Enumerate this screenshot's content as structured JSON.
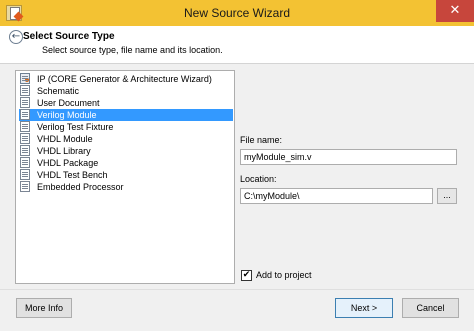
{
  "window": {
    "title": "New Source Wizard",
    "close_glyph": "✕",
    "app_icon": "ise-wizard-icon"
  },
  "header": {
    "back_glyph": "←",
    "title": "Select Source Type",
    "subtitle": "Select source type, file name and its location."
  },
  "source_types": [
    {
      "label": "IP (CORE Generator & Architecture Wizard)",
      "icon": "ip-core-icon",
      "selected": false
    },
    {
      "label": "Schematic",
      "icon": "document-icon",
      "selected": false
    },
    {
      "label": "User Document",
      "icon": "document-icon",
      "selected": false
    },
    {
      "label": "Verilog Module",
      "icon": "document-icon",
      "selected": true
    },
    {
      "label": "Verilog Test Fixture",
      "icon": "document-icon",
      "selected": false
    },
    {
      "label": "VHDL Module",
      "icon": "document-icon",
      "selected": false
    },
    {
      "label": "VHDL Library",
      "icon": "document-icon",
      "selected": false
    },
    {
      "label": "VHDL Package",
      "icon": "document-icon",
      "selected": false
    },
    {
      "label": "VHDL Test Bench",
      "icon": "document-icon",
      "selected": false
    },
    {
      "label": "Embedded Processor",
      "icon": "document-icon",
      "selected": false
    }
  ],
  "form": {
    "file_name_label": "File name:",
    "file_name_value": "myModule_sim.v",
    "location_label": "Location:",
    "location_value": "C:\\myModule\\",
    "browse_label": "...",
    "add_to_project_label": "Add to project",
    "add_to_project_checked": true,
    "check_glyph": "✔"
  },
  "buttons": {
    "more_info": "More Info",
    "next": "Next >",
    "cancel": "Cancel"
  },
  "colors": {
    "titlebar": "#f3c233",
    "selection": "#3399ff",
    "close": "#c7463c"
  }
}
